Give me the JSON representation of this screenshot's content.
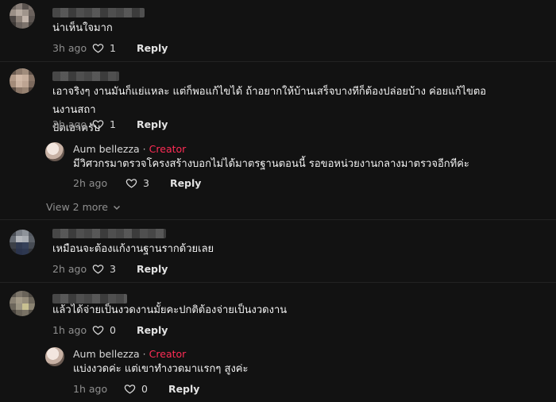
{
  "comments": [
    {
      "text": "น่าเห็นใจมาก",
      "time": "3h ago",
      "likes": "1",
      "reply_label": "Reply"
    },
    {
      "text": "เอาจริงๆ งานมันก็แย่แหละ แต่ก็พอแก้ไขได้ ถ้าอยากให้บ้านเสร็จบางทีก็ต้องปล่อยบ้าง ค่อยแก้ไขตอนงานสถา\nปัตเอาครับ",
      "time": "2h ago",
      "likes": "1",
      "reply_label": "Reply",
      "reply": {
        "author": "Aum bellezza",
        "separator": "·",
        "badge": "Creator",
        "text": "มีวิศวกรมาตรวจโครงสร้างบอกไม่ได้มาตรฐานตอนนี้ รอขอหน่วยงานกลางมาตรวจอีกทีค่ะ",
        "time": "2h ago",
        "likes": "3",
        "reply_label": "Reply"
      },
      "view_more": "View 2 more"
    },
    {
      "text": "เหมือนจะต้องแก้งานฐานรากด้วยเลย",
      "time": "2h ago",
      "likes": "3",
      "reply_label": "Reply"
    },
    {
      "text": "แล้วได้จ่ายเป็นงวดงานมั้ยคะปกติต้องจ่ายเป็นงวดงาน",
      "time": "1h ago",
      "likes": "0",
      "reply_label": "Reply",
      "reply": {
        "author": "Aum bellezza",
        "separator": "·",
        "badge": "Creator",
        "text": "แบ่งงวดค่ะ แต่เขาทำงวดมาแรกๆ สูงค่ะ",
        "time": "1h ago",
        "likes": "0",
        "reply_label": "Reply"
      }
    }
  ],
  "icons": {
    "like": "heart-outline-icon",
    "expand": "chevron-down-icon"
  },
  "colors": {
    "background": "#121212",
    "creator_badge": "#fe2c55"
  }
}
